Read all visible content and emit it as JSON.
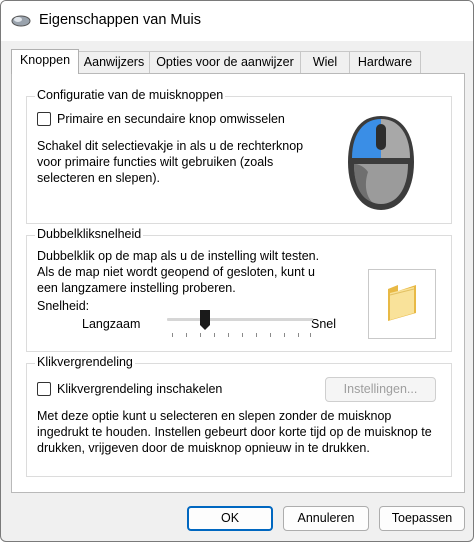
{
  "window": {
    "title": "Eigenschappen van Muis",
    "icon": "mouse-icon"
  },
  "tabs": [
    {
      "label": "Knoppen",
      "active": true
    },
    {
      "label": "Aanwijzers",
      "active": false
    },
    {
      "label": "Opties voor de aanwijzer",
      "active": false
    },
    {
      "label": "Wiel",
      "active": false
    },
    {
      "label": "Hardware",
      "active": false
    }
  ],
  "button_config": {
    "title": "Configuratie van de muisknoppen",
    "checkbox_label": "Primaire en secundaire knop omwisselen",
    "checked": false,
    "description": [
      "Schakel dit selectievakje in als u de rechterknop",
      "voor primaire functies wilt gebruiken (zoals",
      "selecteren en slepen)."
    ],
    "image": "mouse-illustration"
  },
  "double_click": {
    "title": "Dubbelkliksnelheid",
    "description": [
      "Dubbelklik op de map als u de instelling wilt testen.",
      "Als de map niet wordt geopend of gesloten, kunt u",
      "een langzamere instelling proberen."
    ],
    "speed_label": "Snelheid:",
    "slow_label": "Langzaam",
    "fast_label": "Snel",
    "speed_value": 0.27,
    "test_icon": "folder-icon"
  },
  "click_lock": {
    "title": "Klikvergrendeling",
    "checkbox_label": "Klikvergrendeling inschakelen",
    "checked": false,
    "settings_button": "Instellingen...",
    "description": [
      "Met deze optie kunt u selecteren en slepen zonder de muisknop",
      "ingedrukt te houden. Instellen gebeurt door korte tijd op de muisknop te",
      "drukken, vrijgeven door de muisknop opnieuw in te drukken."
    ]
  },
  "footer": {
    "ok": "OK",
    "cancel": "Annuleren",
    "apply": "Toepassen"
  },
  "colors": {
    "accent": "#0067c0",
    "mouse_highlight": "#3a8ee6",
    "folder": "#f5d36c"
  }
}
